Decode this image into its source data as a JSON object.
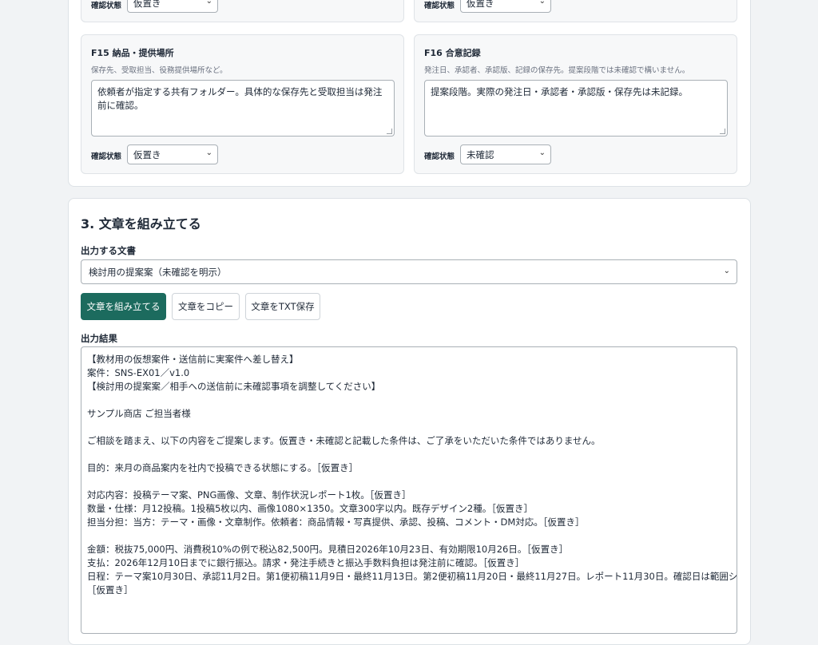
{
  "top_cards": {
    "left": {
      "status_label": "確認状態",
      "status_value": "仮置き"
    },
    "right": {
      "status_label": "確認状態",
      "status_value": "仮置き"
    }
  },
  "f15": {
    "title": "F15 納品・提供場所",
    "hint": "保存先、受取担当、役務提供場所など。",
    "text": "依頼者が指定する共有フォルダー。具体的な保存先と受取担当は発注前に確認。",
    "status_label": "確認状態",
    "status_value": "仮置き"
  },
  "f16": {
    "title": "F16 合意記録",
    "hint": "発注日、承認者、承認版、記録の保存先。提案段階では未確認で構いません。",
    "text": "提案段階。実際の発注日・承認者・承認版・保存先は未記録。",
    "status_label": "確認状態",
    "status_value": "未確認"
  },
  "section3": {
    "title": "3. 文章を組み立てる",
    "output_label": "出力する文書",
    "output_select": "検討用の提案案（未確認を明示）",
    "buttons": {
      "assemble": "文章を組み立てる",
      "copy": "文章をコピー",
      "save_txt": "文章をTXT保存"
    },
    "result_label": "出力結果",
    "result_lines": [
      "【教材用の仮想案件・送信前に実案件へ差し替え】",
      "案件：SNS-EX01／v1.0",
      "【検討用の提案案／相手への送信前に未確認事項を調整してください】",
      "",
      "サンプル商店 ご担当者様",
      "",
      "ご相談を踏まえ、以下の内容をご提案します。仮置き・未確認と記載した条件は、ご了承をいただいた条件ではありません。",
      "",
      "目的：来月の商品案内を社内で投稿できる状態にする。［仮置き］",
      "",
      "対応内容：投稿テーマ案、PNG画像、文章、制作状況レポート1枚。［仮置き］",
      "数量・仕様：月12投稿。1投稿5枚以内、画像1080×1350。文章300字以内。既存デザイン2種。［仮置き］",
      "担当分担：当方：テーマ・画像・文章制作。依頼者：商品情報・写真提供、承認、投稿、コメント・DM対応。［仮置き］",
      "",
      "金額：税抜75,000円、消費税10%の例で税込82,500円。見積日2026年10月23日、有効期限10月26日。［仮置き］",
      "支払：2026年12月10日までに銀行振込。請求・発注手続きと振込手数料負担は発注前に確認。［仮置き］",
      "日程：テーマ案10月30日、承認11月2日。第1便初稿11月9日・最終11月13日。第2便初稿11月20日・最終11月27日。レポート11月30日。確認日は範囲シートを参照。",
      "［仮置き］"
    ]
  }
}
